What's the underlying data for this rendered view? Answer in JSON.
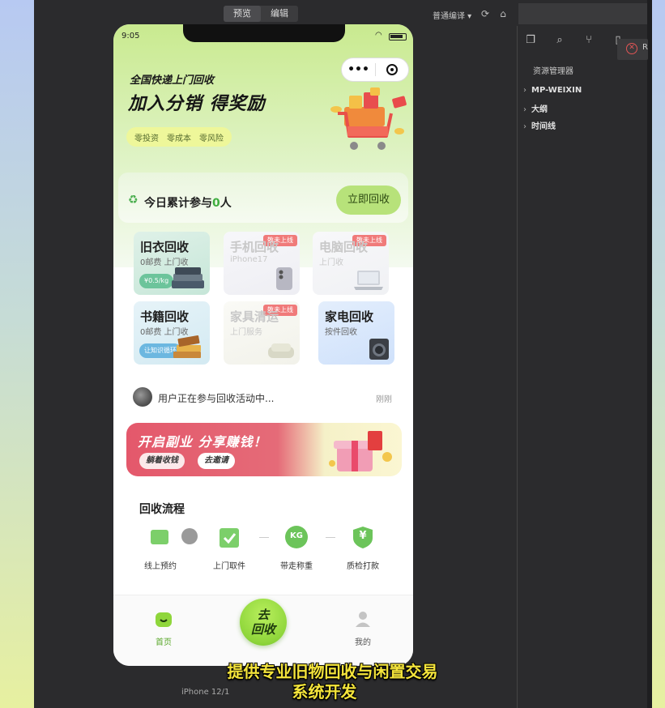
{
  "toolbar": {
    "mode_preview": "预览",
    "mode_edit": "编辑",
    "compile_mode": "普通编译 ▾"
  },
  "explorer": {
    "title": "资源管理器",
    "items": [
      "MP-WEIXIN",
      "大纲",
      "时间线"
    ],
    "close_label": "R"
  },
  "status_bar": {
    "time": "9:05"
  },
  "capsule": {
    "more": "•••"
  },
  "hero": {
    "subtitle": "全国快递上门回收",
    "title": "加入分销 得奖励",
    "tags": [
      "零投资",
      "零成本",
      "零风险"
    ]
  },
  "summary": {
    "prefix": "今日累计参与",
    "count": "0",
    "suffix": "人",
    "button": "立即回收"
  },
  "categories": [
    {
      "title": "旧衣回收",
      "sub": "0邮费 上门收",
      "pill": "¥0.5/kg",
      "badge": "",
      "disabled": false
    },
    {
      "title": "手机回收",
      "sub": "iPhone17",
      "pill": "",
      "badge": "敬未上线",
      "disabled": true
    },
    {
      "title": "电脑回收",
      "sub": "上门收",
      "pill": "",
      "badge": "敬未上线",
      "disabled": true
    },
    {
      "title": "书籍回收",
      "sub": "0邮费 上门收",
      "pill": "让知识循环",
      "badge": "",
      "disabled": false
    },
    {
      "title": "家具清运",
      "sub": "上门服务",
      "pill": "",
      "badge": "敬未上线",
      "disabled": true
    },
    {
      "title": "家电回收",
      "sub": "按件回收",
      "pill": "",
      "badge": "",
      "disabled": false
    }
  ],
  "ticker": {
    "text": "用户正在参与回收活动中...",
    "time": "刚刚"
  },
  "promo": {
    "title": "开启副业 分享赚钱！",
    "pill_1": "躺着收钱",
    "pill_2": "去邀请"
  },
  "flow": {
    "title": "回收流程",
    "steps": [
      "线上预约",
      "上门取件",
      "带走称重",
      "质检打款"
    ],
    "kg_label": "KG",
    "yen_label": "¥"
  },
  "tabbar": {
    "home": "首页",
    "center_line1": "去",
    "center_line2": "回收",
    "mine": "我的"
  },
  "device": {
    "label": "iPhone 12/1"
  },
  "caption": {
    "line1": "提供专业旧物回收与闲置交易",
    "line2": "系统开发"
  },
  "colors": {
    "accent_green": "#8fd63b",
    "ide_bg": "#2b2b2d",
    "promo_red": "#e4586b",
    "caption_yellow": "#f4e43b"
  }
}
